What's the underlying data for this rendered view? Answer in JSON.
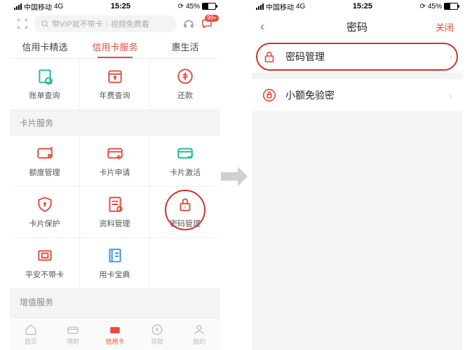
{
  "status": {
    "carrier": "中国移动",
    "network": "4G",
    "time": "15:25",
    "battery": "45%"
  },
  "left": {
    "search_placeholder": "带VIP就不带卡｜视频免费看",
    "msg_badge": "99+",
    "tabs": [
      "信用卡精选",
      "信用卡服务",
      "惠生活"
    ],
    "top_items": [
      "账单查询",
      "年费查询",
      "还款"
    ],
    "section1_title": "卡片服务",
    "section1_items": [
      "额度管理",
      "卡片申请",
      "卡片激活",
      "卡片保护",
      "资料管理",
      "密码管理",
      "平安不带卡",
      "用卡宝典"
    ],
    "section2_title": "增值服务",
    "nav": [
      "首页",
      "理财",
      "信用卡",
      "贷款",
      "我的"
    ]
  },
  "right": {
    "title": "密码",
    "close": "关闭",
    "rows": [
      "密码管理",
      "小额免验密"
    ]
  },
  "colors": {
    "accent": "#e74c3c"
  }
}
